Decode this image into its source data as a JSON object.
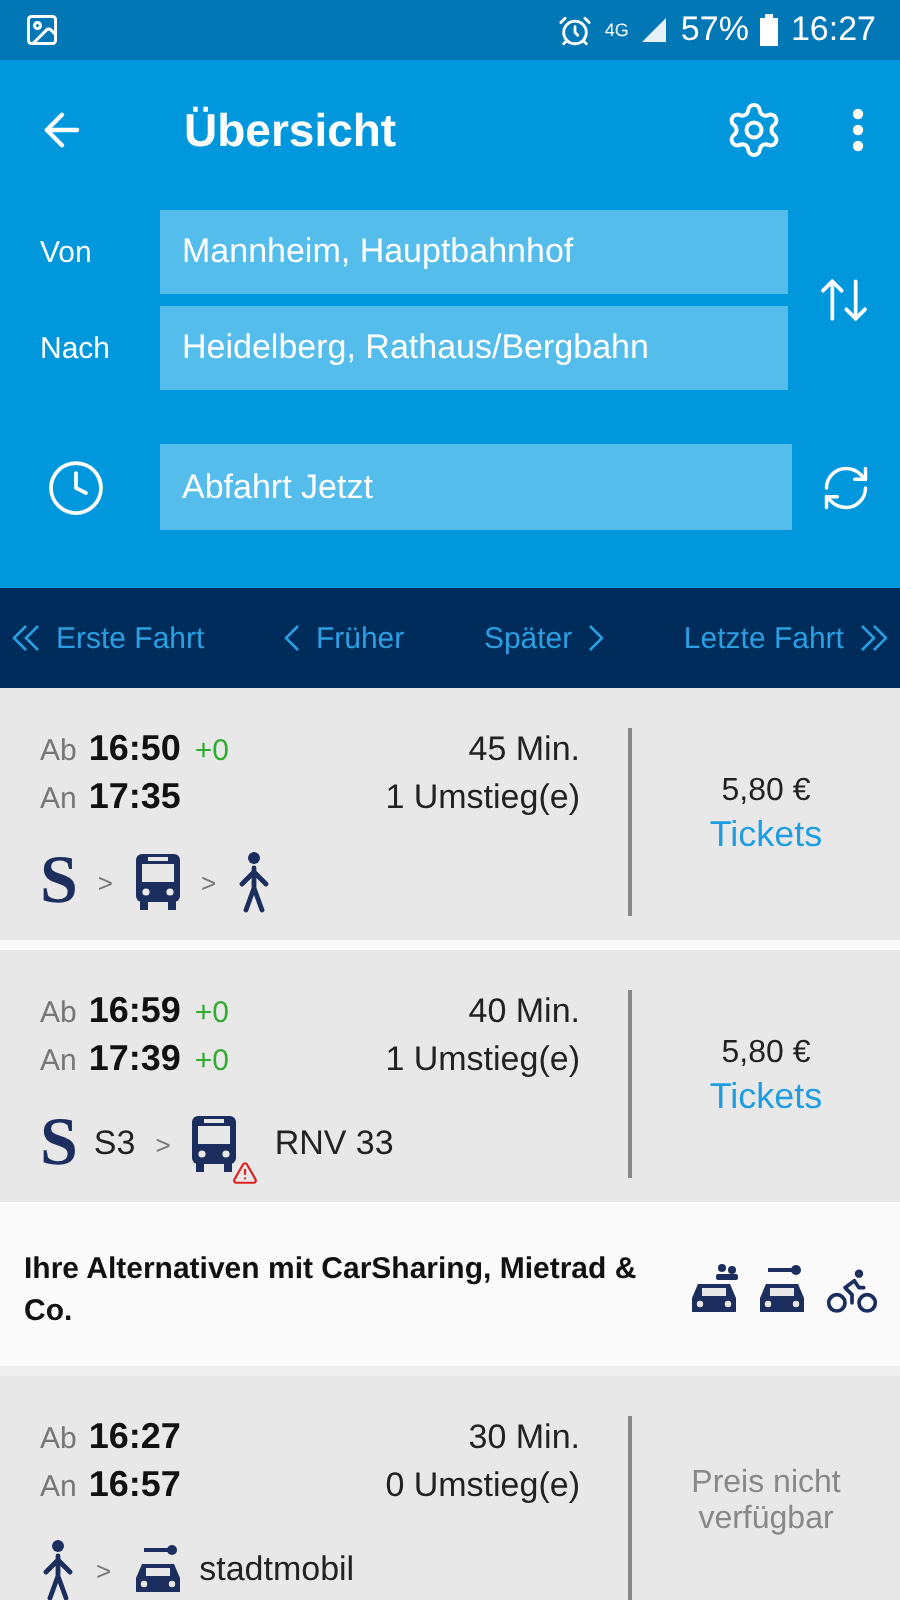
{
  "status_bar": {
    "network": "4G",
    "battery": "57%",
    "time": "16:27"
  },
  "toolbar": {
    "title": "Übersicht"
  },
  "form": {
    "from_label": "Von",
    "from": "Mannheim, Hauptbahnhof",
    "to_label": "Nach",
    "to": "Heidelberg, Rathaus/Bergbahn",
    "time": "Abfahrt Jetzt"
  },
  "nav": [
    {
      "label": "Erste Fahrt",
      "kind": "first"
    },
    {
      "label": "Früher",
      "kind": "earlier"
    },
    {
      "label": "Später",
      "kind": "later"
    },
    {
      "label": "Letzte Fahrt",
      "kind": "last"
    }
  ],
  "connections": [
    {
      "kind": "trip",
      "dep_label": "Ab",
      "dep": "16:50",
      "dep_delay": "+0",
      "arr_label": "An",
      "arr": "17:35",
      "duration": "45 Min.",
      "changes": "1 Umstieg(e)",
      "price": "5,80 €",
      "price_available": true,
      "tickets": "Tickets",
      "legs": [
        {
          "kind": "s-bahn",
          "symbol": "S"
        },
        {
          "kind": "arrow",
          "text": ">"
        },
        {
          "kind": "bus",
          "warning": false
        },
        {
          "kind": "arrow",
          "text": ">"
        },
        {
          "kind": "walk"
        }
      ]
    },
    {
      "kind": "trip",
      "dep_label": "Ab",
      "dep": "16:59",
      "dep_delay": "+0",
      "arr_label": "An",
      "arr": "17:39",
      "arr_delay": "+0",
      "duration": "40 Min.",
      "changes": "1 Umstieg(e)",
      "price": "5,80 €",
      "price_available": true,
      "tickets": "Tickets",
      "legs": [
        {
          "kind": "s-bahn",
          "symbol": "S",
          "line": "S3"
        },
        {
          "kind": "arrow",
          "text": ">"
        },
        {
          "kind": "bus",
          "warning": true,
          "line": "RNV 33"
        }
      ]
    },
    {
      "kind": "alternatives",
      "text": "Ihre Alternativen mit CarSharing, Mietrad & Co.",
      "icons": [
        {
          "kind": "carpool"
        },
        {
          "kind": "car"
        },
        {
          "kind": "bike"
        }
      ]
    },
    {
      "kind": "trip",
      "dep_label": "Ab",
      "dep": "16:27",
      "arr_label": "An",
      "arr": "16:57",
      "duration": "30 Min.",
      "changes": "0 Umstieg(e)",
      "price": "Preis nicht verfügbar",
      "price_available": false,
      "legs": [
        {
          "kind": "walk"
        },
        {
          "kind": "arrow",
          "text": ">"
        },
        {
          "kind": "car",
          "line": "stadtmobil"
        }
      ]
    }
  ]
}
